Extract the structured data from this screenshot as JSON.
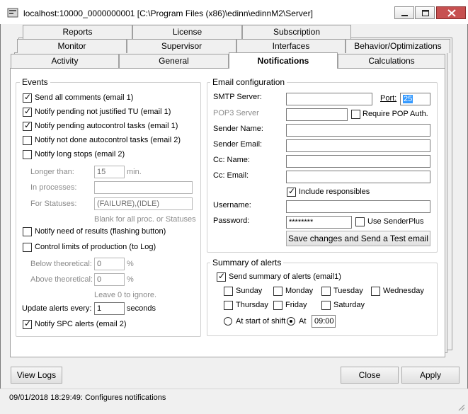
{
  "window": {
    "title": "localhost:10000_0000000001 [C:\\Program Files (x86)\\edinn\\edinnM2\\Server]"
  },
  "tabs": {
    "row1": [
      "Reports",
      "License",
      "Subscription"
    ],
    "row2": [
      "Monitor",
      "Supervisor",
      "Interfaces",
      "Behavior/Optimizations"
    ],
    "row3": [
      "Activity",
      "General",
      "Notifications",
      "Calculations"
    ]
  },
  "events": {
    "legend": "Events",
    "send_all": "Send all comments (email 1)",
    "not_justified": "Notify pending not justified TU (email 1)",
    "autocontrol": "Notify pending autocontrol tasks (email 1)",
    "not_done": "Notify not done autocontrol tasks (email 2)",
    "long_stops": "Notify long stops (email 2)",
    "longer_than": "Longer than:",
    "longer_value": "15",
    "min": "min.",
    "in_processes": "In processes:",
    "processes_value": "",
    "for_statuses": "For Statuses:",
    "statuses_value": "(FAILURE),(IDLE)",
    "blank_hint": "Blank for all proc. or Statuses",
    "need_results": "Notify need of results (flashing button)",
    "control_limits": "Control limits of production (to Log)",
    "below": "Below theoretical:",
    "below_value": "0",
    "above": "Above theoretical:",
    "above_value": "0",
    "percent": "%",
    "leave_hint": "Leave 0 to ignore.",
    "update_every": "Update alerts every:",
    "update_value": "1",
    "seconds": "seconds",
    "spc": "Notify SPC alerts (email 2)"
  },
  "email": {
    "legend": "Email configuration",
    "smtp": "SMTP Server:",
    "smtp_value": "",
    "port": "Port:",
    "port_value": "25",
    "pop3": "POP3 Server",
    "pop3_value": "",
    "require_pop": "Require POP Auth.",
    "sender_name": "Sender Name:",
    "sender_email": "Sender Email:",
    "cc_name": "Cc: Name:",
    "cc_email": "Cc: Email:",
    "include_resp": "Include responsibles",
    "username": "Username:",
    "password": "Password:",
    "password_value": "********",
    "use_senderplus": "Use SenderPlus",
    "save_test": "Save changes and Send a Test email"
  },
  "summary": {
    "legend": "Summary of alerts",
    "send_summary": "Send summary of alerts (email1)",
    "days": [
      "Sunday",
      "Monday",
      "Tuesday",
      "Wednesday",
      "Thursday",
      "Friday",
      "Saturday"
    ],
    "start_shift": "At start of shift",
    "at": "At",
    "at_time": "09:00"
  },
  "buttons": {
    "view_logs": "View Logs",
    "close": "Close",
    "apply": "Apply"
  },
  "status": "09/01/2018 18:29:49: Configures notifications"
}
